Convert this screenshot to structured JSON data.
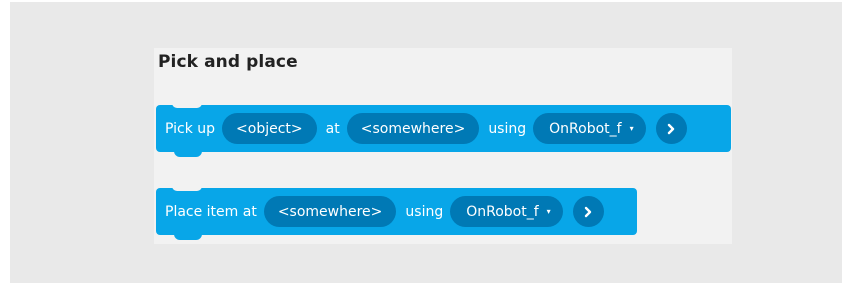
{
  "panel": {
    "title": "Pick and place"
  },
  "blocks": [
    {
      "parts": [
        {
          "label": "Pick up"
        },
        {
          "field": "<object>"
        },
        {
          "label": "at"
        },
        {
          "field": "<somewhere>"
        },
        {
          "label": "using"
        },
        {
          "dropdown": "OnRobot_f"
        }
      ],
      "next_icon": "chevron-right-icon"
    },
    {
      "parts": [
        {
          "label": "Place item at"
        },
        {
          "field": "<somewhere>"
        },
        {
          "label": "using"
        },
        {
          "dropdown": "OnRobot_f"
        }
      ],
      "next_icon": "chevron-right-icon"
    }
  ],
  "colors": {
    "block": "#08a6e8",
    "field": "#0079b5",
    "panel": "#f2f2f2",
    "outer": "#e9e9e9"
  },
  "icons": {
    "dropdown_caret": "▾",
    "next": "chevron-right-icon"
  }
}
